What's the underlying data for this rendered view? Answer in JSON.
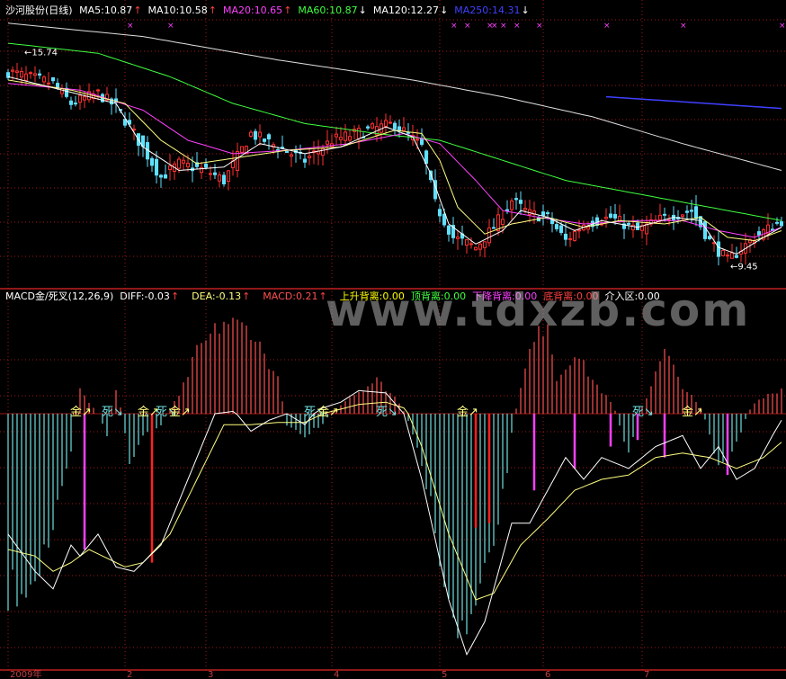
{
  "colors": {
    "background": "#000000",
    "grid": "#a01818",
    "up_candle": "#ff3030",
    "down_candle": "#60e0ff",
    "ma5": "#ffffff",
    "ma10": "#ffff80",
    "ma20": "#ff40ff",
    "ma60": "#40ff40",
    "ma120": "#e0e0e0",
    "ma250": "#4040ff",
    "macd_pos": "#ff5050",
    "macd_neg": "#70e0e0",
    "diff": "#ffffff",
    "dea": "#ffff80",
    "divergence": "#ff40ff"
  },
  "price_header": {
    "stock": "沙河股份(日线)",
    "items": [
      {
        "label": "MA5:10.87",
        "color": "#ffffff",
        "arrow": "↑",
        "arrow_dir": "up"
      },
      {
        "label": "MA10:10.58",
        "color": "#ffffff",
        "arrow": "↑",
        "arrow_dir": "up"
      },
      {
        "label": "MA20:10.65",
        "color": "#ff40ff",
        "arrow": "↑",
        "arrow_dir": "up"
      },
      {
        "label": "MA60:10.87",
        "color": "#40ff40",
        "arrow": "↓",
        "arrow_dir": "down"
      },
      {
        "label": "MA120:12.27",
        "color": "#ffffff",
        "arrow": "↓",
        "arrow_dir": "down"
      },
      {
        "label": "MA250:14.31",
        "color": "#4040ff",
        "arrow": "↓",
        "arrow_dir": "down"
      }
    ]
  },
  "macd_header": {
    "items": [
      {
        "label": "MACD金/死叉(12,26,9)",
        "color": "#ffffff"
      },
      {
        "label": "DIFF:-0.03",
        "color": "#ffffff",
        "arrow": "↑"
      },
      {
        "label": "DEA:-0.13",
        "color": "#ffff80",
        "arrow": "↑"
      },
      {
        "label": "MACD:0.21",
        "color": "#ff5050",
        "arrow": "↑"
      },
      {
        "label": "上升背离:0.00",
        "color": "#ffff00"
      },
      {
        "label": "顶背离:0.00",
        "color": "#40ff40"
      },
      {
        "label": "下降背离:0.00",
        "color": "#ff40ff"
      },
      {
        "label": "底背离:0.00",
        "color": "#ff4040"
      },
      {
        "label": "介入区:0.00",
        "color": "#ffffff"
      }
    ]
  },
  "watermark": "www.tdxzb.com",
  "chart_data": [
    {
      "type": "candlestick",
      "title": "沙河股份(日线)",
      "ylim": [
        8.9,
        16.8
      ],
      "price_annotations": [
        {
          "index": 2,
          "value": 15.74,
          "label": "15.74"
        },
        {
          "index": 159,
          "value": 9.45,
          "label": "9.45"
        }
      ],
      "top_markers": [
        {
          "index": 27,
          "symbol": "×"
        },
        {
          "index": 36,
          "symbol": "×"
        },
        {
          "index": 99,
          "symbol": "×"
        },
        {
          "index": 102,
          "symbol": "×"
        },
        {
          "index": 107,
          "symbol": "×"
        },
        {
          "index": 108,
          "symbol": "×"
        },
        {
          "index": 110,
          "symbol": "×"
        },
        {
          "index": 113,
          "symbol": "×"
        },
        {
          "index": 118,
          "symbol": "×"
        },
        {
          "index": 133,
          "symbol": "×"
        },
        {
          "index": 150,
          "symbol": "×"
        },
        {
          "index": 172,
          "symbol": "×"
        }
      ],
      "segments": [
        [
          0,
          15.25
        ],
        [
          10,
          14.9
        ],
        [
          14,
          14.3
        ],
        [
          20,
          14.6
        ],
        [
          24,
          14.2
        ],
        [
          28,
          13.4
        ],
        [
          34,
          12.1
        ],
        [
          38,
          12.5
        ],
        [
          44,
          12.3
        ],
        [
          48,
          12.0
        ],
        [
          54,
          13.4
        ],
        [
          60,
          13.0
        ],
        [
          66,
          12.6
        ],
        [
          72,
          13.2
        ],
        [
          80,
          13.5
        ],
        [
          86,
          13.7
        ],
        [
          92,
          13.0
        ],
        [
          95,
          11.3
        ],
        [
          99,
          10.3
        ],
        [
          104,
          10.0
        ],
        [
          108,
          10.6
        ],
        [
          112,
          11.4
        ],
        [
          116,
          11.0
        ],
        [
          120,
          10.9
        ],
        [
          124,
          10.2
        ],
        [
          128,
          10.7
        ],
        [
          134,
          10.9
        ],
        [
          140,
          10.5
        ],
        [
          146,
          10.9
        ],
        [
          152,
          11.1
        ],
        [
          156,
          10.2
        ],
        [
          160,
          9.6
        ],
        [
          166,
          10.3
        ],
        [
          172,
          10.8
        ]
      ],
      "ma5_segments": [
        [
          0,
          15.1
        ],
        [
          12,
          14.7
        ],
        [
          24,
          14.3
        ],
        [
          30,
          13.0
        ],
        [
          38,
          12.3
        ],
        [
          48,
          12.4
        ],
        [
          56,
          13.1
        ],
        [
          66,
          12.8
        ],
        [
          74,
          13.0
        ],
        [
          84,
          13.6
        ],
        [
          90,
          13.3
        ],
        [
          94,
          12.2
        ],
        [
          98,
          10.7
        ],
        [
          104,
          10.1
        ],
        [
          110,
          10.5
        ],
        [
          114,
          11.1
        ],
        [
          120,
          10.9
        ],
        [
          126,
          10.5
        ],
        [
          132,
          10.8
        ],
        [
          140,
          10.6
        ],
        [
          148,
          10.9
        ],
        [
          154,
          10.8
        ],
        [
          158,
          10.0
        ],
        [
          162,
          9.8
        ],
        [
          168,
          10.3
        ],
        [
          172,
          10.6
        ]
      ],
      "ma10_segments": [
        [
          0,
          15.0
        ],
        [
          14,
          14.7
        ],
        [
          26,
          14.3
        ],
        [
          34,
          13.2
        ],
        [
          42,
          12.5
        ],
        [
          52,
          12.7
        ],
        [
          62,
          12.9
        ],
        [
          74,
          13.0
        ],
        [
          86,
          13.5
        ],
        [
          92,
          13.4
        ],
        [
          96,
          12.6
        ],
        [
          100,
          11.2
        ],
        [
          106,
          10.4
        ],
        [
          112,
          10.7
        ],
        [
          120,
          10.9
        ],
        [
          128,
          10.6
        ],
        [
          136,
          10.8
        ],
        [
          146,
          10.7
        ],
        [
          154,
          10.9
        ],
        [
          160,
          10.3
        ],
        [
          166,
          10.2
        ],
        [
          172,
          10.5
        ]
      ],
      "ma20_segments": [
        [
          0,
          14.9
        ],
        [
          16,
          14.7
        ],
        [
          30,
          14.1
        ],
        [
          40,
          13.2
        ],
        [
          50,
          12.8
        ],
        [
          62,
          12.9
        ],
        [
          76,
          13.1
        ],
        [
          88,
          13.4
        ],
        [
          96,
          13.1
        ],
        [
          104,
          12.0
        ],
        [
          110,
          11.1
        ],
        [
          118,
          10.9
        ],
        [
          128,
          10.7
        ],
        [
          140,
          10.8
        ],
        [
          150,
          10.8
        ],
        [
          158,
          10.5
        ],
        [
          166,
          10.3
        ],
        [
          172,
          10.6
        ]
      ],
      "ma60_segments": [
        [
          0,
          16.1
        ],
        [
          20,
          15.8
        ],
        [
          36,
          15.1
        ],
        [
          50,
          14.3
        ],
        [
          66,
          13.7
        ],
        [
          82,
          13.4
        ],
        [
          96,
          13.2
        ],
        [
          110,
          12.6
        ],
        [
          124,
          12.0
        ],
        [
          140,
          11.6
        ],
        [
          156,
          11.2
        ],
        [
          172,
          10.8
        ]
      ],
      "ma120_segments": [
        [
          0,
          16.7
        ],
        [
          30,
          16.3
        ],
        [
          60,
          15.6
        ],
        [
          90,
          15.0
        ],
        [
          110,
          14.5
        ],
        [
          130,
          13.9
        ],
        [
          150,
          13.1
        ],
        [
          172,
          12.3
        ]
      ],
      "ma250_segments": [
        [
          133,
          14.5
        ],
        [
          150,
          14.35
        ],
        [
          172,
          14.15
        ]
      ]
    },
    {
      "type": "bar",
      "title": "MACD金/死叉(12,26,9)",
      "ylim": [
        -1.15,
        0.95
      ],
      "macd_segments": [
        [
          0,
          -0.85
        ],
        [
          6,
          -0.75
        ],
        [
          10,
          -0.55
        ],
        [
          14,
          -0.2
        ],
        [
          16,
          0.25
        ],
        [
          18,
          0.1
        ],
        [
          22,
          -0.1
        ],
        [
          24,
          0.2
        ],
        [
          27,
          -0.25
        ],
        [
          30,
          -0.1
        ],
        [
          34,
          -0.05
        ],
        [
          38,
          0.15
        ],
        [
          42,
          0.55
        ],
        [
          48,
          0.82
        ],
        [
          54,
          0.75
        ],
        [
          60,
          0.3
        ],
        [
          62,
          -0.05
        ],
        [
          66,
          -0.1
        ],
        [
          70,
          -0.05
        ],
        [
          76,
          0.15
        ],
        [
          82,
          0.3
        ],
        [
          86,
          0.15
        ],
        [
          90,
          -0.1
        ],
        [
          95,
          -0.5
        ],
        [
          98,
          -0.95
        ],
        [
          102,
          -1.05
        ],
        [
          106,
          -0.8
        ],
        [
          110,
          -0.4
        ],
        [
          113,
          0.05
        ],
        [
          116,
          0.55
        ],
        [
          120,
          0.85
        ],
        [
          122,
          0.3
        ],
        [
          126,
          0.55
        ],
        [
          130,
          0.3
        ],
        [
          134,
          0.1
        ],
        [
          138,
          -0.2
        ],
        [
          142,
          0.15
        ],
        [
          146,
          0.55
        ],
        [
          150,
          0.25
        ],
        [
          154,
          0.05
        ],
        [
          158,
          -0.25
        ],
        [
          162,
          -0.15
        ],
        [
          166,
          0.1
        ],
        [
          170,
          0.2
        ],
        [
          172,
          0.21
        ]
      ],
      "diff_segments": [
        [
          0,
          -0.55
        ],
        [
          6,
          -0.72
        ],
        [
          10,
          -0.8
        ],
        [
          14,
          -0.6
        ],
        [
          16,
          -0.65
        ],
        [
          20,
          -0.55
        ],
        [
          24,
          -0.7
        ],
        [
          28,
          -0.72
        ],
        [
          34,
          -0.6
        ],
        [
          40,
          -0.3
        ],
        [
          46,
          0.0
        ],
        [
          50,
          0.02
        ],
        [
          54,
          -0.08
        ],
        [
          58,
          -0.03
        ],
        [
          62,
          0.0
        ],
        [
          66,
          -0.05
        ],
        [
          70,
          0.05
        ],
        [
          74,
          0.1
        ],
        [
          78,
          0.2
        ],
        [
          84,
          0.18
        ],
        [
          88,
          0.0
        ],
        [
          92,
          -0.3
        ],
        [
          98,
          -0.85
        ],
        [
          102,
          -1.1
        ],
        [
          106,
          -0.95
        ],
        [
          112,
          -0.5
        ],
        [
          116,
          -0.5
        ],
        [
          120,
          -0.35
        ],
        [
          124,
          -0.2
        ],
        [
          128,
          -0.3
        ],
        [
          132,
          -0.2
        ],
        [
          138,
          -0.25
        ],
        [
          144,
          -0.15
        ],
        [
          150,
          -0.1
        ],
        [
          154,
          -0.25
        ],
        [
          158,
          -0.15
        ],
        [
          162,
          -0.3
        ],
        [
          166,
          -0.25
        ],
        [
          170,
          -0.1
        ],
        [
          172,
          -0.03
        ]
      ],
      "dea_segments": [
        [
          0,
          -0.62
        ],
        [
          6,
          -0.65
        ],
        [
          10,
          -0.72
        ],
        [
          14,
          -0.68
        ],
        [
          18,
          -0.62
        ],
        [
          22,
          -0.66
        ],
        [
          26,
          -0.7
        ],
        [
          30,
          -0.68
        ],
        [
          36,
          -0.55
        ],
        [
          42,
          -0.3
        ],
        [
          48,
          -0.05
        ],
        [
          54,
          -0.05
        ],
        [
          60,
          -0.04
        ],
        [
          66,
          -0.04
        ],
        [
          72,
          0.02
        ],
        [
          78,
          0.08
        ],
        [
          84,
          0.1
        ],
        [
          88,
          0.05
        ],
        [
          92,
          -0.15
        ],
        [
          98,
          -0.55
        ],
        [
          104,
          -0.85
        ],
        [
          108,
          -0.82
        ],
        [
          114,
          -0.6
        ],
        [
          120,
          -0.48
        ],
        [
          126,
          -0.35
        ],
        [
          132,
          -0.3
        ],
        [
          138,
          -0.28
        ],
        [
          144,
          -0.2
        ],
        [
          150,
          -0.18
        ],
        [
          156,
          -0.2
        ],
        [
          162,
          -0.25
        ],
        [
          168,
          -0.2
        ],
        [
          172,
          -0.13
        ]
      ],
      "divergence_bars": [
        [
          17,
          -0.62
        ],
        [
          32,
          -0.68
        ],
        [
          104,
          -0.52
        ],
        [
          107,
          -0.5
        ],
        [
          117,
          -0.35
        ],
        [
          126,
          -0.25
        ],
        [
          134,
          -0.15
        ],
        [
          140,
          -0.12
        ],
        [
          146,
          -0.2
        ],
        [
          160,
          -0.28
        ]
      ],
      "signals": [
        {
          "index": 15,
          "label": "金↗",
          "color": "#ffff80"
        },
        {
          "index": 22,
          "label": "死↘",
          "color": "#70e0e0"
        },
        {
          "index": 30,
          "label": "金↗",
          "color": "#ffff80"
        },
        {
          "index": 34,
          "label": "死↘",
          "color": "#70e0e0"
        },
        {
          "index": 37,
          "label": "金↗",
          "color": "#ffff80"
        },
        {
          "index": 67,
          "label": "死↘",
          "color": "#70e0e0"
        },
        {
          "index": 70,
          "label": "金↗",
          "color": "#ffff80"
        },
        {
          "index": 83,
          "label": "死↘",
          "color": "#70e0e0"
        },
        {
          "index": 101,
          "label": "金↗",
          "color": "#ffff80"
        },
        {
          "index": 140,
          "label": "死↘",
          "color": "#70e0e0"
        },
        {
          "index": 151,
          "label": "金↗",
          "color": "#ffff80"
        }
      ],
      "x_ticks": [
        {
          "index": 0,
          "label": "2009年"
        },
        {
          "index": 26,
          "label": "2"
        },
        {
          "index": 44,
          "label": "3"
        },
        {
          "index": 72,
          "label": "4"
        },
        {
          "index": 96,
          "label": "5"
        },
        {
          "index": 119,
          "label": "6"
        },
        {
          "index": 141,
          "label": "7"
        }
      ]
    }
  ]
}
